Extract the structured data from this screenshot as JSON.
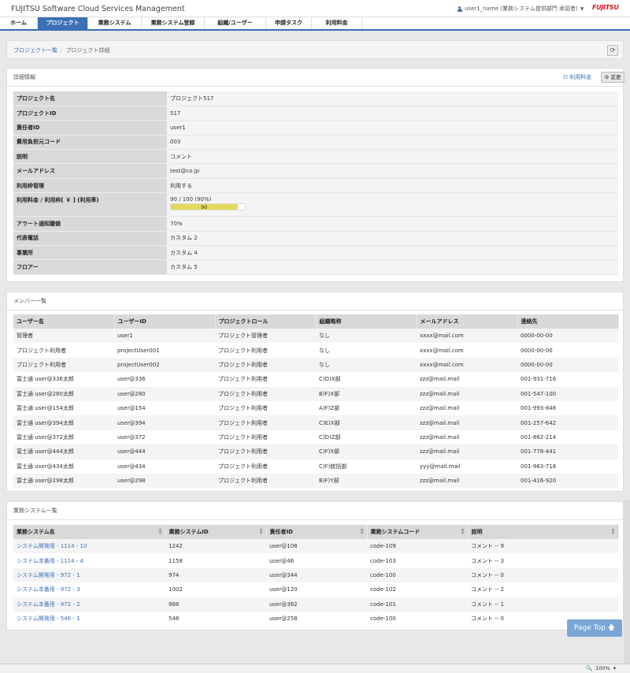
{
  "header": {
    "brand": "FUJITSU Software Cloud Services Management",
    "user": "user1_name (業務システム提供部門 承認者)",
    "logo": "FUJITSU"
  },
  "nav": [
    {
      "label": "ホーム",
      "active": false
    },
    {
      "label": "プロジェクト",
      "active": true
    },
    {
      "label": "業務システム",
      "active": false
    },
    {
      "label": "業務システム登録",
      "active": false
    },
    {
      "label": "組織/ユーザー",
      "active": false
    },
    {
      "label": "申請タスク",
      "active": false
    },
    {
      "label": "利用料金",
      "active": false
    }
  ],
  "breadcrumb": {
    "parent": "プロジェクト一覧",
    "current": "プロジェクト詳細"
  },
  "detail": {
    "title": "詳細情報",
    "fee_link": "利用料金",
    "change_button": "変更",
    "rows": [
      {
        "label": "プロジェクト名",
        "value": "プロジェクト517"
      },
      {
        "label": "プロジェクトID",
        "value": "517"
      },
      {
        "label": "責任者ID",
        "value": "user1"
      },
      {
        "label": "費用負担元コード",
        "value": "003"
      },
      {
        "label": "説明",
        "value": "コメント"
      },
      {
        "label": "メールアドレス",
        "value": "test@co.jp"
      },
      {
        "label": "利用枠管理",
        "value": "利用する"
      }
    ],
    "usage": {
      "label": "利用料金 / 利用枠[ ￥ ] (利用率)",
      "value": "90 / 100 (90%)",
      "bar_label": "90",
      "percent": 90
    },
    "rows2": [
      {
        "label": "アラート通知閾値",
        "value": "70%"
      },
      {
        "label": "代表電話",
        "value": "カスタム 2"
      },
      {
        "label": "事業所",
        "value": "カスタム 4"
      },
      {
        "label": "フロアー",
        "value": "カスタム 5"
      }
    ]
  },
  "members": {
    "title": "メンバー一覧",
    "columns": [
      "ユーザー名",
      "ユーザーID",
      "プロジェクトロール",
      "組織略称",
      "メールアドレス",
      "連絡先"
    ],
    "rows": [
      [
        "管理者",
        "user1",
        "プロジェクト管理者",
        "なし",
        "xxxx@mail.com",
        "0000-00-00"
      ],
      [
        "プロジェクト利用者",
        "projectUser001",
        "プロジェクト利用者",
        "なし",
        "xxxx@mail.com",
        "0000-00-00"
      ],
      [
        "プロジェクト利用者",
        "projectUser002",
        "プロジェクト利用者",
        "なし",
        "xxxx@mail.com",
        "0000-00-00"
      ],
      [
        "富士通 user@336太郎",
        "user@336",
        "プロジェクト利用者",
        "C)D)X部",
        "zzz@mail.mail",
        "001-931-716"
      ],
      [
        "富士通 user@280太郎",
        "user@280",
        "プロジェクト利用者",
        "B)F)X部",
        "zzz@mail.mail",
        "001-547-100"
      ],
      [
        "富士通 user@154太郎",
        "user@154",
        "プロジェクト利用者",
        "A)F)Z部",
        "zzz@mail.mail",
        "001-993-848"
      ],
      [
        "富士通 user@394太郎",
        "user@394",
        "プロジェクト利用者",
        "C)E)X部",
        "zzz@mail.mail",
        "001-257-642"
      ],
      [
        "富士通 user@372太郎",
        "user@372",
        "プロジェクト利用者",
        "C)D)Z部",
        "zzz@mail.mail",
        "001-862-214"
      ],
      [
        "富士通 user@444太郎",
        "user@444",
        "プロジェクト利用者",
        "C)F)X部",
        "zzz@mail.mail",
        "001-778-441"
      ],
      [
        "富士通 user@434太郎",
        "user@434",
        "プロジェクト利用者",
        "C)F)統括部",
        "yyy@mail.mail",
        "001-963-718"
      ],
      [
        "富士通 user@298太郎",
        "user@298",
        "プロジェクト利用者",
        "B)F)Y部",
        "zzz@mail.mail",
        "001-416-920"
      ]
    ]
  },
  "systems": {
    "title": "業務システム一覧",
    "columns": [
      "業務システム名",
      "業務システムID",
      "責任者ID",
      "業務システムコード",
      "説明"
    ],
    "rows": [
      [
        "システム開発用 - 1114 - 10",
        "1242",
        "user@108",
        "code-109",
        "コメント -- 9"
      ],
      [
        "システム本番用 - 1114 - 4",
        "1158",
        "user@46",
        "code-103",
        "コメント -- 3"
      ],
      [
        "システム開発用 - 972 - 1",
        "974",
        "user@344",
        "code-100",
        "コメント -- 0"
      ],
      [
        "システム本番用 - 972 - 3",
        "1002",
        "user@120",
        "code-102",
        "コメント -- 2"
      ],
      [
        "システム本番用 - 972 - 2",
        "988",
        "user@362",
        "code-101",
        "コメント -- 1"
      ],
      [
        "システム開発用 - 546 - 1",
        "548",
        "user@258",
        "code-100",
        "コメント -- 0"
      ]
    ]
  },
  "page_top": "Page Top",
  "status": {
    "zoom": "100%"
  },
  "colors": {
    "primary": "#3b6fb6",
    "bar": "#e4d95a",
    "label_bg": "#d9d9d9"
  }
}
